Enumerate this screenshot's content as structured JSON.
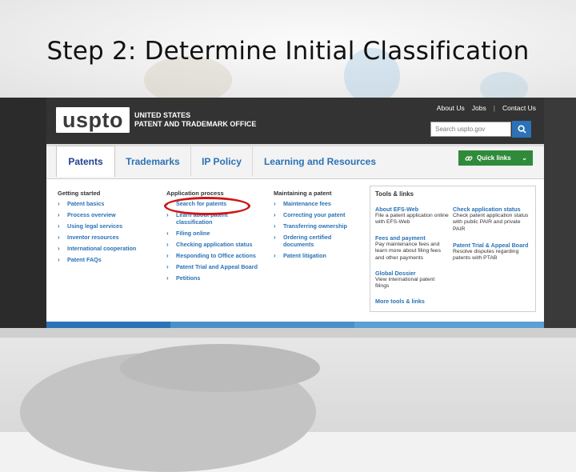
{
  "slide": {
    "title": "Step 2: Determine Initial Classification"
  },
  "header": {
    "logo": "uspto",
    "agency_line1": "UNITED STATES",
    "agency_line2": "PATENT AND TRADEMARK OFFICE",
    "top_links": [
      "About Us",
      "Jobs",
      "Contact Us"
    ],
    "search_placeholder": "Search uspto.gov"
  },
  "nav": {
    "tabs": [
      "Patents",
      "Trademarks",
      "IP Policy",
      "Learning and Resources"
    ],
    "active_tab": "Patents",
    "quick_links": "Quick links"
  },
  "columns": [
    {
      "heading": "Getting started",
      "items": [
        "Patent basics",
        "Process overview",
        "Using legal services",
        "Inventor resources",
        "International cooperation",
        "Patent FAQs"
      ]
    },
    {
      "heading": "Application process",
      "items": [
        "Search for patents",
        "Learn about patent classification",
        "Filing online",
        "Checking application status",
        "Responding to Office actions",
        "Patent Trial and Appeal Board",
        "Petitions"
      ]
    },
    {
      "heading": "Maintaining a patent",
      "items": [
        "Maintenance fees",
        "Correcting your patent",
        "Transferring ownership",
        "Ordering certified documents",
        "Patent litigation"
      ]
    }
  ],
  "tools": {
    "title": "Tools & links",
    "entries": [
      {
        "link": "About EFS-Web",
        "desc": "File a patent application online with EFS-Web"
      },
      {
        "link": "Check application status",
        "desc": "Check patent application status with public PAIR and private PAIR"
      },
      {
        "link": "Fees and payment",
        "desc": "Pay maintenance fees and learn more about filing fees and other payments"
      },
      {
        "link": "Patent Trial & Appeal Board",
        "desc": "Resolve disputes regarding patents with PTAB"
      },
      {
        "link": "Global Dossier",
        "desc": "View international patent filings"
      }
    ],
    "more": "More tools & links"
  },
  "colors": {
    "accent": "#2b72b6",
    "header": "#333333",
    "quick_links": "#2f8a3a",
    "highlight": "#d01515"
  }
}
